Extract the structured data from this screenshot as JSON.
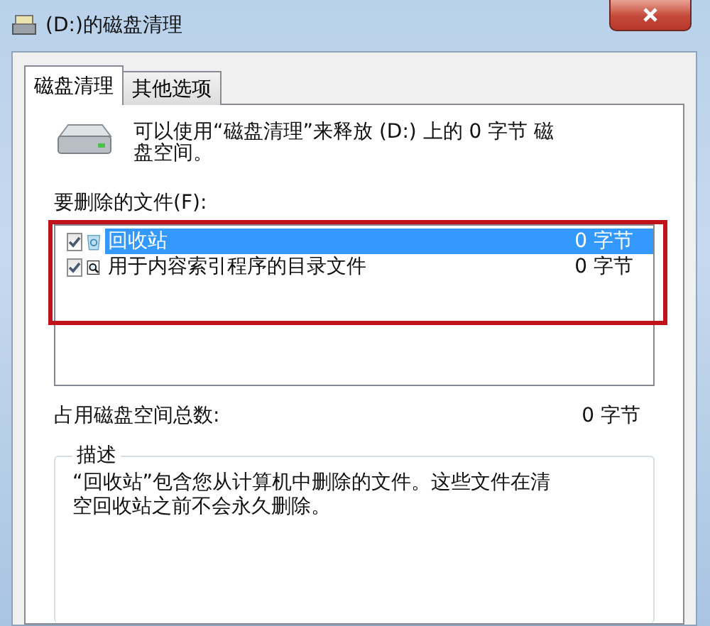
{
  "window": {
    "title": "(D:)的磁盘清理"
  },
  "tabs": [
    {
      "label": "磁盘清理",
      "selected": true
    },
    {
      "label": "其他选项",
      "selected": false
    }
  ],
  "summary": "可以使用“磁盘清理”来释放  (D:) 上的 0 字节 磁盘空间。",
  "files_label": "要删除的文件(F):",
  "files": [
    {
      "name": "回收站",
      "size": "0 字节",
      "checked": true,
      "selected": true,
      "kind": "recycle"
    },
    {
      "name": "用于内容索引程序的目录文件",
      "size": "0 字节",
      "checked": true,
      "selected": false,
      "kind": "catalog"
    }
  ],
  "total": {
    "label": "占用磁盘空间总数:",
    "value": "0 字节"
  },
  "description": {
    "title": "描述",
    "text": "“回收站”包含您从计算机中删除的文件。这些文件在清空回收站之前不会永久删除。"
  }
}
